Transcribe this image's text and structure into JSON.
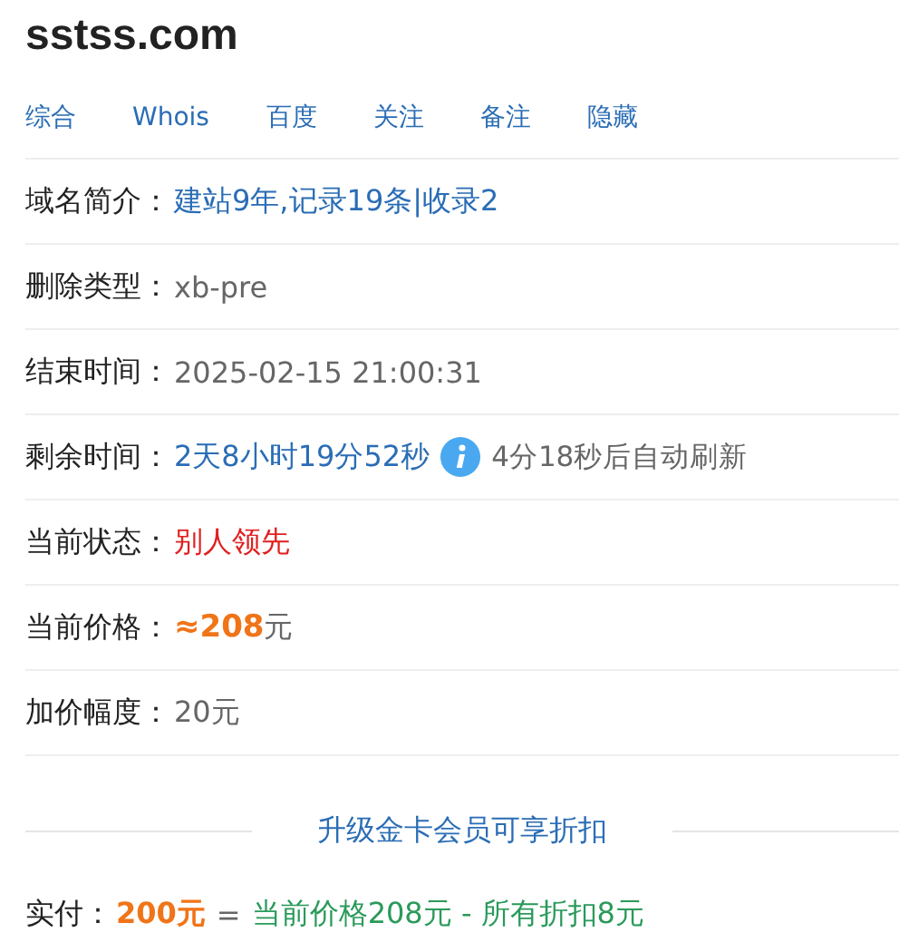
{
  "title": "sstss.com",
  "links": [
    "综合",
    "Whois",
    "百度",
    "关注",
    "备注",
    "隐藏"
  ],
  "rows": [
    {
      "kind": "link",
      "label": "域名简介：",
      "value": "建站9年,记录19条|收录2"
    },
    {
      "kind": "plain",
      "label": "删除类型：",
      "value": "xb-pre"
    },
    {
      "kind": "plain",
      "label": "结束时间：",
      "value": "2025-02-15 21:00:31"
    },
    {
      "kind": "countdown",
      "label": "剩余时间：",
      "value": "2天8小时19分52秒",
      "note": "4分18秒后自动刷新"
    },
    {
      "kind": "alert",
      "label": "当前状态：",
      "value": "别人领先"
    },
    {
      "kind": "price",
      "label": "当前价格：",
      "value": "≈208",
      "unit": "元"
    },
    {
      "kind": "plain",
      "label": "加价幅度：",
      "value": "20元"
    }
  ],
  "promo": "升级金卡会员可享折扣",
  "payment": {
    "label": "实付：",
    "amount": "200元",
    "equals": "=",
    "formula": "当前价格208元 - 所有折扣8元"
  }
}
